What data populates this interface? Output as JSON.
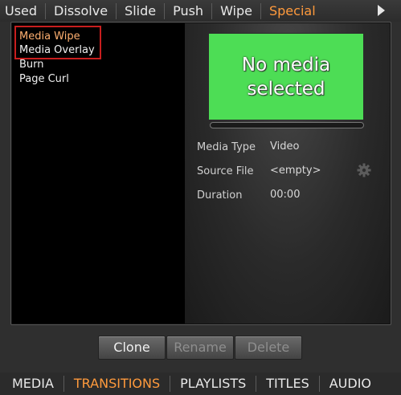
{
  "top_tabs": [
    {
      "label": "Used",
      "active": false
    },
    {
      "label": "Dissolve",
      "active": false
    },
    {
      "label": "Slide",
      "active": false
    },
    {
      "label": "Push",
      "active": false
    },
    {
      "label": "Wipe",
      "active": false
    },
    {
      "label": "Special",
      "active": true
    }
  ],
  "list": {
    "items": [
      {
        "label": "Media Wipe",
        "selected": true
      },
      {
        "label": "Media Overlay",
        "selected": false
      },
      {
        "label": "Burn",
        "selected": false
      },
      {
        "label": "Page Curl",
        "selected": false
      }
    ]
  },
  "preview": {
    "text_line1": "No media",
    "text_line2": "selected",
    "background_color": "#4ddd55"
  },
  "info": {
    "media_type_label": "Media Type",
    "media_type_value": "Video",
    "source_file_label": "Source File",
    "source_file_value": "<empty>",
    "duration_label": "Duration",
    "duration_value": "00:00",
    "settings_icon": "gear-icon"
  },
  "buttons": {
    "clone": "Clone",
    "rename": "Rename",
    "delete": "Delete"
  },
  "bottom_tabs": [
    {
      "label": "MEDIA",
      "active": false
    },
    {
      "label": "TRANSITIONS",
      "active": true
    },
    {
      "label": "PLAYLISTS",
      "active": false
    },
    {
      "label": "TITLES",
      "active": false
    },
    {
      "label": "AUDIO",
      "active": false
    }
  ],
  "colors": {
    "accent": "#ff9a3c",
    "selection_box": "#c81e1e"
  }
}
